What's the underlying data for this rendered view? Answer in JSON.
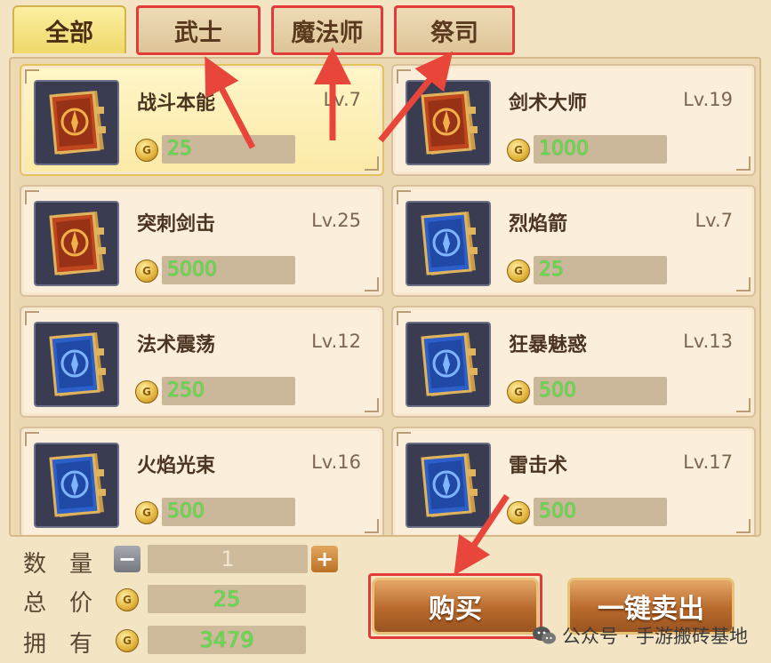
{
  "tabs": [
    {
      "label": "全部",
      "active": true,
      "highlighted": false
    },
    {
      "label": "武士",
      "active": false,
      "highlighted": true
    },
    {
      "label": "魔法师",
      "active": false,
      "highlighted": true
    },
    {
      "label": "祭司",
      "active": false,
      "highlighted": true
    }
  ],
  "skills": [
    {
      "name": "战斗本能",
      "level": "Lv.7",
      "price": "25",
      "book": "red",
      "selected": true
    },
    {
      "name": "剑术大师",
      "level": "Lv.19",
      "price": "1000",
      "book": "red",
      "selected": false
    },
    {
      "name": "突刺剑击",
      "level": "Lv.25",
      "price": "5000",
      "book": "red",
      "selected": false
    },
    {
      "name": "烈焰箭",
      "level": "Lv.7",
      "price": "25",
      "book": "blue",
      "selected": false
    },
    {
      "name": "法术震荡",
      "level": "Lv.12",
      "price": "250",
      "book": "blue",
      "selected": false
    },
    {
      "name": "狂暴魅惑",
      "level": "Lv.13",
      "price": "500",
      "book": "blue",
      "selected": false
    },
    {
      "name": "火焰光束",
      "level": "Lv.16",
      "price": "500",
      "book": "blue",
      "selected": false
    },
    {
      "name": "雷击术",
      "level": "Lv.17",
      "price": "500",
      "book": "blue",
      "selected": false
    }
  ],
  "purchase": {
    "quantity_label": "数量",
    "quantity_value": "1",
    "minus_symbol": "−",
    "plus_symbol": "+",
    "total_label": "总价",
    "total_value": "25",
    "owned_label": "拥有",
    "owned_value": "3479"
  },
  "buttons": {
    "buy": "购买",
    "sell_all": "一键卖出"
  },
  "watermark": "公众号 · 手游搬砖基地",
  "colors": {
    "price_text": "#5ee04a",
    "highlight": "#e33a3a",
    "active_tab": "#f0d96a",
    "button": "#b86a2c"
  },
  "icons": [
    "coin-icon",
    "red-skill-book-icon",
    "blue-skill-book-icon",
    "minus-icon",
    "plus-icon",
    "wechat-icon"
  ]
}
